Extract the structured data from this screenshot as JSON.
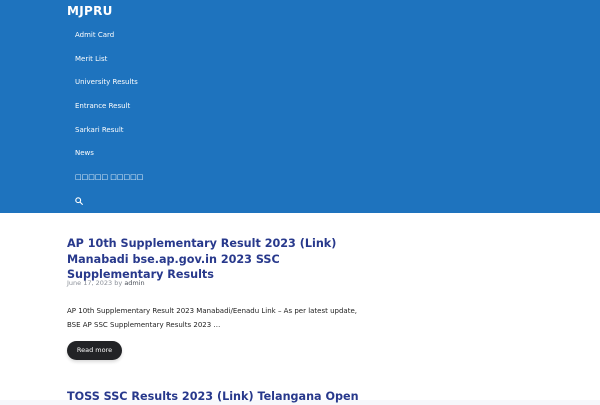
{
  "site": {
    "title": "MJPRU"
  },
  "nav": {
    "items": [
      {
        "label": "Admit Card"
      },
      {
        "label": "Merit List"
      },
      {
        "label": "University Results"
      },
      {
        "label": "Entrance Result"
      },
      {
        "label": "Sarkari Result"
      },
      {
        "label": "News"
      },
      {
        "label": "□□□□□ □□□□□"
      }
    ],
    "search_icon": "search-icon"
  },
  "posts": [
    {
      "title": "AP 10th Supplementary Result 2023 (Link) Manabadi bse.ap.gov.in 2023 SSC Supplementary Results",
      "date": "June 17, 2023",
      "by": "by",
      "author": "admin",
      "excerpt": "AP 10th Supplementary Result 2023 Manabadi/Eenadu Link – As per latest update, BSE AP SSC Supplementary Results 2023 …",
      "read_more": "Read more"
    },
    {
      "title": "TOSS SSC Results 2023 (Link) Telangana Open"
    }
  ],
  "colors": {
    "header": "#1e73be",
    "title": "#28398c",
    "button": "#222326"
  }
}
